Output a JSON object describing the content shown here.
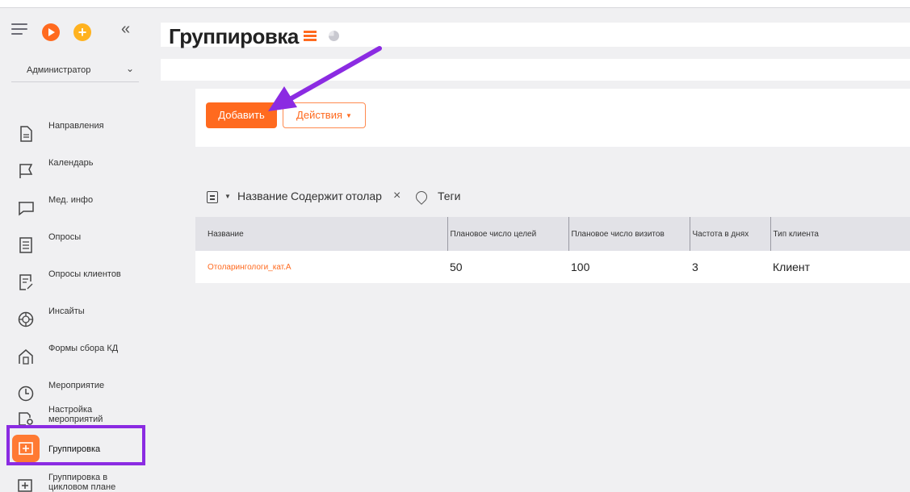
{
  "sidebar": {
    "role": "Администратор",
    "items": [
      {
        "label": "Направления",
        "icon": "document-icon"
      },
      {
        "label": "Календарь",
        "icon": "flag-icon"
      },
      {
        "label": "Мед. инфо",
        "icon": "chat-icon"
      },
      {
        "label": "Опросы",
        "icon": "list-document-icon"
      },
      {
        "label": "Опросы клиентов",
        "icon": "edit-document-icon"
      },
      {
        "label": "Инсайты",
        "icon": "target-icon"
      },
      {
        "label": "Формы сбора КД",
        "icon": "building-icon"
      },
      {
        "label": "Мероприятие",
        "icon": "clock-icon"
      },
      {
        "label": "Настройка мероприятий",
        "icon": "settings-folder-icon"
      },
      {
        "label": "Группировка",
        "icon": "group-add-icon",
        "active": true
      },
      {
        "label": "Группировка в цикловом плане",
        "icon": "group-add-icon"
      }
    ]
  },
  "header": {
    "title": "Группировка"
  },
  "toolbar": {
    "add_label": "Добавить",
    "actions_label": "Действия"
  },
  "filter": {
    "field": "Название",
    "operator": "Содержит",
    "value": "отолар",
    "clear": "×",
    "tags_label": "Теги"
  },
  "table": {
    "columns": [
      "Название",
      "Плановое число целей",
      "Плановое число визитов",
      "Частота в днях",
      "Тип клиента"
    ],
    "rows": [
      [
        "Отоларингологи_кат.А",
        "50",
        "100",
        "3",
        "Клиент"
      ]
    ]
  },
  "colors": {
    "accent": "#ff6a1f",
    "highlight": "#8b2be2"
  }
}
